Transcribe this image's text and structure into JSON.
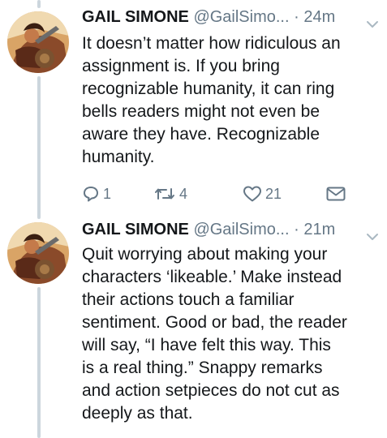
{
  "tweets": [
    {
      "name": "GAIL SIMONE",
      "handle": "@GailSimo...",
      "dot": "·",
      "time": "24m",
      "avatar_icon": "comic-art-avatar",
      "text": "It doesn’t matter how ridiculous an\nassignment is. If you bring\nrecognizable humanity, it can ring\nbells readers might not even be\naware they have. Recognizable\nhumanity.",
      "actions": {
        "reply_count": "1",
        "retweet_count": "4",
        "like_count": "21"
      }
    },
    {
      "name": "GAIL SIMONE",
      "handle": "@GailSimo...",
      "dot": "·",
      "time": "21m",
      "avatar_icon": "comic-art-avatar",
      "text": "Quit worrying about making your\ncharacters ‘likeable.’ Make instead\ntheir actions touch a familiar\nsentiment. Good or bad, the reader\nwill say, “I have felt this way. This\nis a real thing.” Snappy remarks\nand action setpieces do not cut as\ndeeply as that."
    }
  ],
  "colors": {
    "text": "#14171a",
    "muted": "#657786",
    "thread_line": "#ccd6dd"
  }
}
